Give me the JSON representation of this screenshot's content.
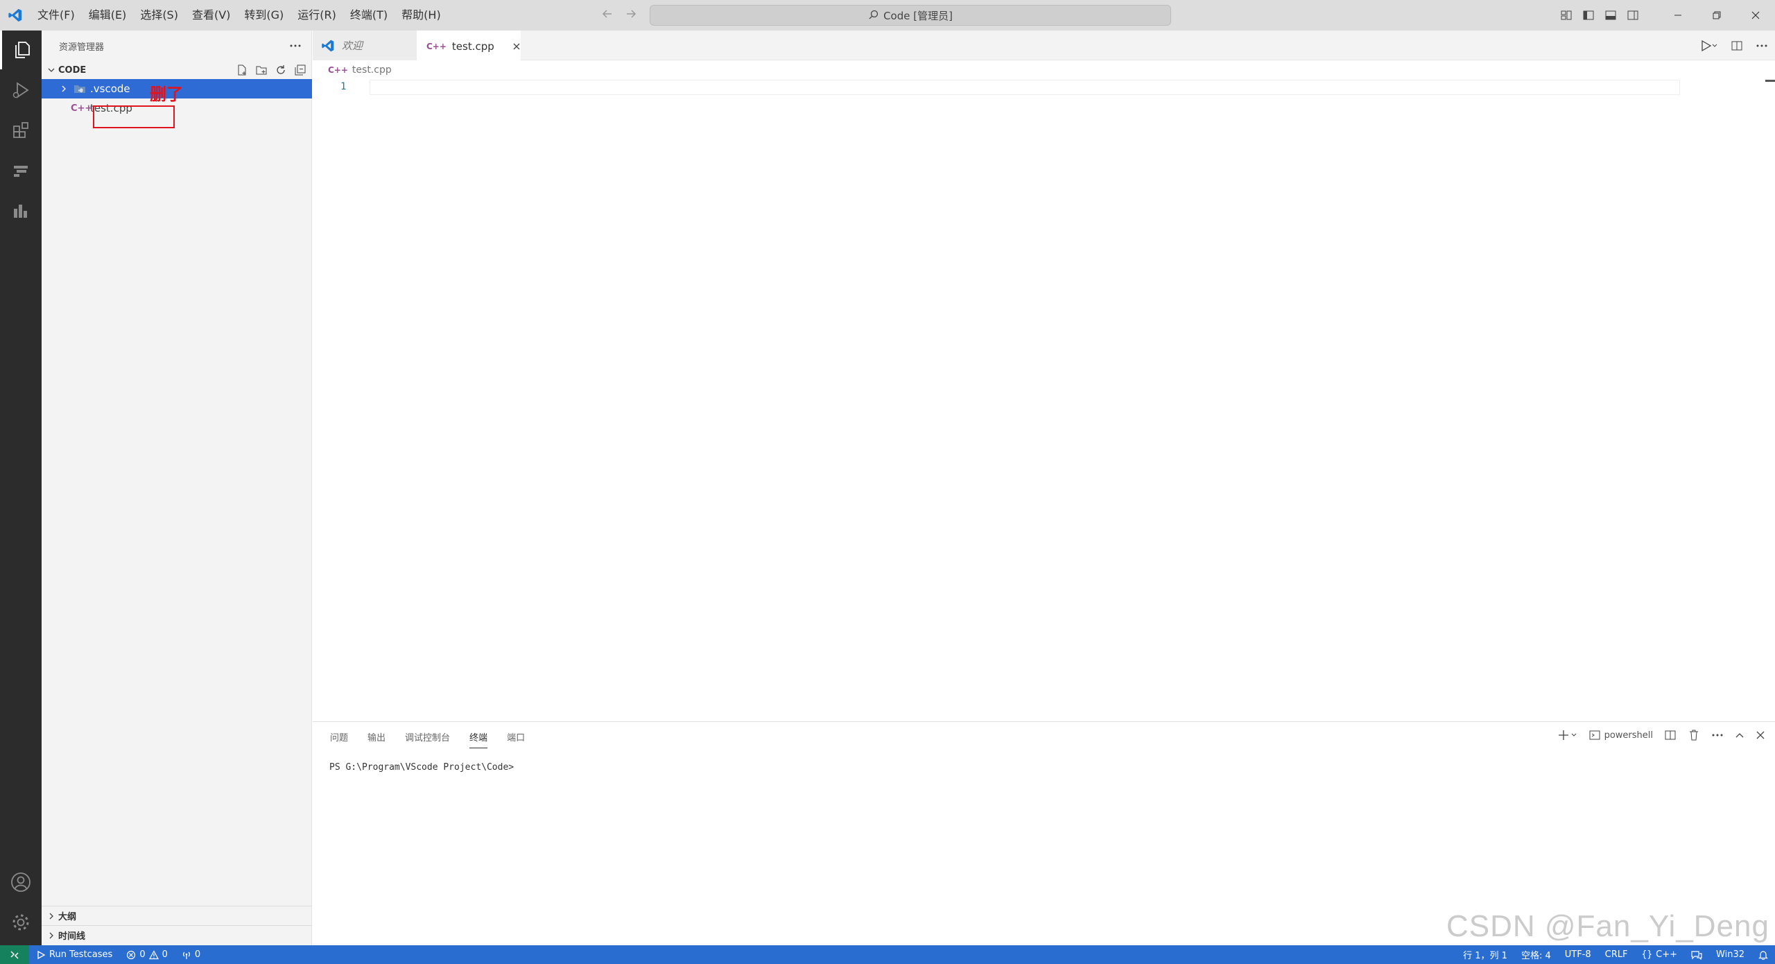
{
  "titlebar": {
    "menu": [
      "文件(F)",
      "编辑(E)",
      "选择(S)",
      "查看(V)",
      "转到(G)",
      "运行(R)",
      "终端(T)",
      "帮助(H)"
    ],
    "command_center": "Code [管理员]"
  },
  "sidebar": {
    "title": "资源管理器",
    "folder": "CODE",
    "items": [
      {
        "label": ".vscode",
        "type": "folder",
        "selected": true
      },
      {
        "label": "test.cpp",
        "type": "file",
        "selected": false
      }
    ],
    "annotation": "删了",
    "bottom_sections": [
      "大纲",
      "时间线"
    ]
  },
  "editor": {
    "tabs": [
      {
        "label": "欢迎",
        "active": false
      },
      {
        "label": "test.cpp",
        "active": true
      }
    ],
    "breadcrumb": "test.cpp",
    "line_number": "1"
  },
  "panel": {
    "tabs": [
      "问题",
      "输出",
      "调试控制台",
      "终端",
      "端口"
    ],
    "active_tab": "终端",
    "shell": "powershell",
    "terminal_line": "PS G:\\Program\\VScode Project\\Code>",
    "watermark": "CSDN @Fan_Yi_Deng"
  },
  "statusbar": {
    "run_testcases": "Run Testcases",
    "errors": "0",
    "warnings": "0",
    "ports": "0",
    "position": "行 1，列 1",
    "spaces": "空格: 4",
    "encoding": "UTF-8",
    "eol": "CRLF",
    "language": "C++",
    "platform": "Win32"
  },
  "colors": {
    "accent": "#2f6bd5",
    "statusbar": "#2a6dd1",
    "remote": "#16825d",
    "annotation": "#e0141e"
  }
}
